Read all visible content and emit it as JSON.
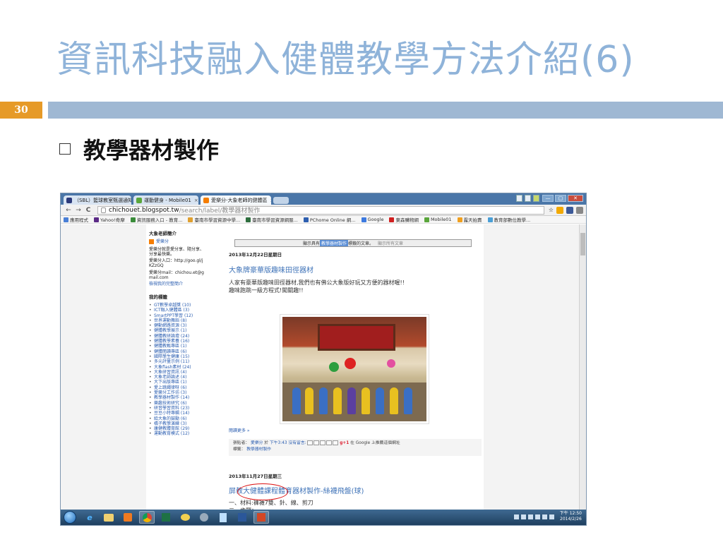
{
  "slide": {
    "title_main": "資訊科技融入健體教學方法介紹",
    "title_suffix": "(6)",
    "page_number": "30",
    "bullet": "教學器材製作",
    "accent_color": "#e69a28",
    "title_color": "#8fb3d9"
  },
  "browser": {
    "tabs": [
      {
        "label": "（SBL）籃球教室甄選通知"
      },
      {
        "label": "運動健身 - Mobile01"
      },
      {
        "label": "愛樂分-大象老師的健體區"
      }
    ],
    "window_controls": [
      "—",
      "▢",
      "✕"
    ],
    "nav": {
      "back": "←",
      "forward": "→",
      "reload": "C"
    },
    "url_host": "chichouet.blogspot.tw",
    "url_path": "/search/label/教學器材製作",
    "star_icon": "☆",
    "bookmarks": [
      "應用程式",
      "Yahoo!奇摩",
      "資訊服務入口 - 教育...",
      "臺南市學習資源中學...",
      "臺南市學習資源網服...",
      "PChome Online 網...",
      "Google",
      "東森購物網",
      "Mobile01",
      "露天拍賣",
      "教育部數位教學..."
    ]
  },
  "sidebar": {
    "profile_heading": "大象老師簡介",
    "blog_name": "愛樂分",
    "desc1": "愛樂分就是愛分享、隨分享、分享最快樂。",
    "desc2": "愛樂分入口：http://goo.gl/jKZzGQ",
    "desc3": "愛樂分mail：chichou.et@gmail.com",
    "profile_link": "檢視我的完整簡介",
    "labels_heading": "我的標籤",
    "labels": [
      "GT數學卓越獎 (10)",
      "ICT融入健體區 (3)",
      "SmartPPT學習 (12)",
      "世界運動舞蹈 (8)",
      "健動網路資源 (3)",
      "健體教學展示 (1)",
      "健體教研論壇 (24)",
      "健體教學素養 (16)",
      "健體教甄專區 (1)",
      "健體閱讀專區 (6)",
      "國際學生健康 (15)",
      "多元評量示例 (11)",
      "大象flash素材 (24)",
      "大象研習資訊 (4)",
      "大象老師論述 (4)",
      "大下出版專區 (1)",
      "愛上跳繩律呀 (6)",
      "愛樂分工作坊 (3)",
      "教學器材製作 (14)",
      "樂趣技術研究 (6)",
      "研習學習資料 (23)",
      "豆豆小特專輯 (14)",
      "給大象的鼓勵 (6)",
      "橋子教學演練 (3)",
      "康健教體育館 (29)",
      "運動教育模式 (12)"
    ]
  },
  "main": {
    "status_prefix": "顯示具有",
    "status_label": "教學器材製作",
    "status_suffix": "標籤的文章。",
    "status_all": "顯示所有文章",
    "post1_date": "2013年12月22日星期日",
    "post1_title": "大象牌豪華版趣味田徑器材",
    "post1_text1": "人家有豪華版趣味田徑器材,我們也有佛公大象版好玩又方便的器材喔!!",
    "post1_text2": "趣味跑跳一級方程式!闖關趣!!",
    "read_more": "閱讀更多 »",
    "meta_posted_by": "張貼者：",
    "meta_author": "愛樂分",
    "meta_at": "於",
    "meta_time": "下午3:43",
    "meta_comments": "沒有留言:",
    "meta_gplus": "g+1",
    "meta_google": "在 Google 上推薦這個網址",
    "meta_tags_label": "標籤：",
    "meta_tag": "教學器材製作",
    "post2_date": "2013年11月27日星期三",
    "post2_title": "屏教大健體課程體育器材製作-絲襪飛盤(球)",
    "post2_line1": "一、材料:褲襪7雙、針、線、剪刀",
    "post2_line2": "二、步驟："
  },
  "taskbar": {
    "apps": [
      "ie-icon",
      "explorer-icon",
      "media-icon",
      "chrome-icon",
      "excel-icon",
      "paint-icon",
      "tool-icon",
      "notepad-icon",
      "word-icon",
      "powerpoint-icon"
    ],
    "tray_time": "下午 12:50",
    "tray_date": "2014/2/26"
  }
}
